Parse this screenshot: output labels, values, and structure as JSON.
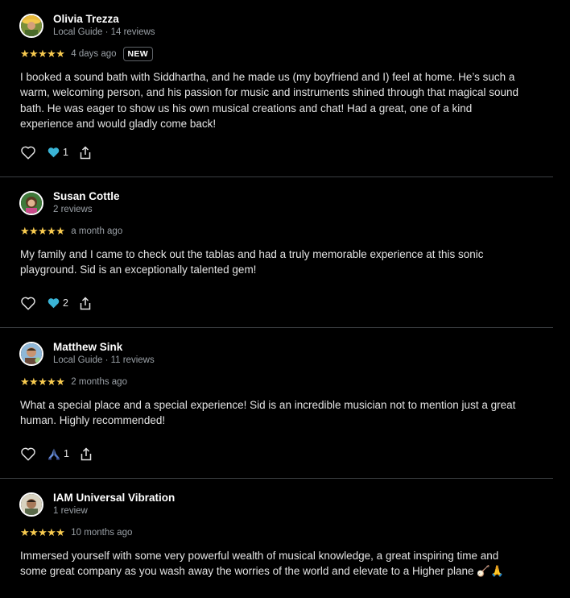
{
  "reviews": [
    {
      "name": "Olivia Trezza",
      "meta": "Local Guide · 14 reviews",
      "stars": "★★★★★",
      "date": "4 days ago",
      "badge": "NEW",
      "text": "I booked a sound bath with Siddhartha, and he made us (my boyfriend and I) feel at home. He’s such a warm, welcoming person, and his passion for music and instruments shined through that magical sound bath. He was eager to show us his own musical creations and chat! Had a great, one of a kind experience and would gladly come back!",
      "reaction_icon": "blue-heart-icon",
      "reaction_count": "1"
    },
    {
      "name": "Susan Cottle",
      "meta": "2 reviews",
      "stars": "★★★★★",
      "date": "a month ago",
      "text": "My family and I came to check out the tablas and had a truly memorable experience at this sonic playground. Sid is an exceptionally talented gem!",
      "reaction_icon": "blue-heart-icon",
      "reaction_count": "2"
    },
    {
      "name": "Matthew Sink",
      "meta": "Local Guide · 11 reviews",
      "stars": "★★★★★",
      "date": "2 months ago",
      "text": "What a special place and a special experience! Sid is an incredible musician not to mention just a great human. Highly recommended!",
      "reaction_icon": "folded-hands-icon",
      "reaction_count": "1"
    },
    {
      "name": "IAM Universal Vibration",
      "meta": "1 review",
      "stars": "★★★★★",
      "date": "10 months ago",
      "text": "Immersed yourself with some very powerful wealth of musical knowledge, a great inspiring time and some great company as you wash away the worries of the world and elevate to a Higher plane 🪕🙏"
    }
  ],
  "colors": {
    "background": "#000000",
    "stars": "#f7ca4f",
    "meta_text": "#9aa0a6",
    "divider": "#3c4043",
    "reaction_heart": "#3ab4d6"
  }
}
